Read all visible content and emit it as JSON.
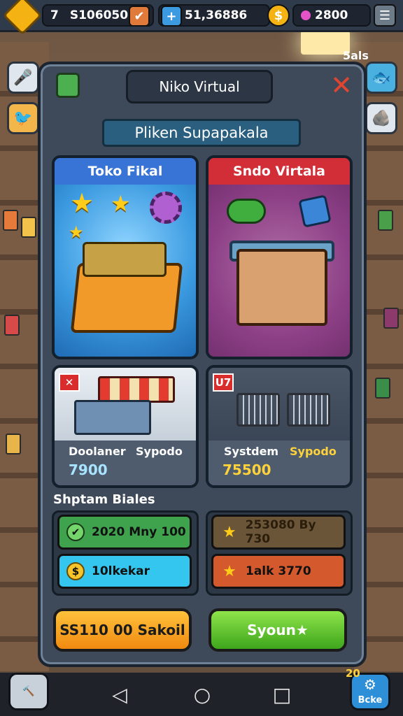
{
  "resources": {
    "level": "7",
    "coins": "S106050",
    "cash": "51,36886",
    "gems": "2800"
  },
  "side_buttons": {
    "right_label": "5als"
  },
  "dialog": {
    "title": "Niko Virtual",
    "subtitle": "Pliken Supapakala"
  },
  "cards": [
    {
      "title": "Toko Fikal"
    },
    {
      "title": "Sndo Virtala"
    }
  ],
  "small_cards": [
    {
      "badge": "✕",
      "label_a": "Doolaner",
      "label_b": "Sypodo",
      "price": "7900"
    },
    {
      "badge": "U7",
      "label_a": "Systdem",
      "label_b": "Sypodo",
      "price": "75500"
    }
  ],
  "section": {
    "label": "Shptam Biales"
  },
  "bonuses": {
    "left": [
      {
        "text": "2020 Mny 100",
        "icon": "check-icon",
        "color": "#3fa34d"
      },
      {
        "text": "10lkekar",
        "icon": "coin-icon",
        "color": "#35c6f0"
      }
    ],
    "right": [
      {
        "text": "253080 By 730",
        "icon": "star-icon",
        "color": "#6b5538"
      },
      {
        "text": "1alk 3770",
        "icon": "star-icon",
        "color": "#d45a2e"
      }
    ]
  },
  "buttons": {
    "orange": "SS110 00 Sakoil",
    "green": "Syoun★"
  },
  "corner": {
    "right_label": "Bcke",
    "right_number": "20"
  }
}
